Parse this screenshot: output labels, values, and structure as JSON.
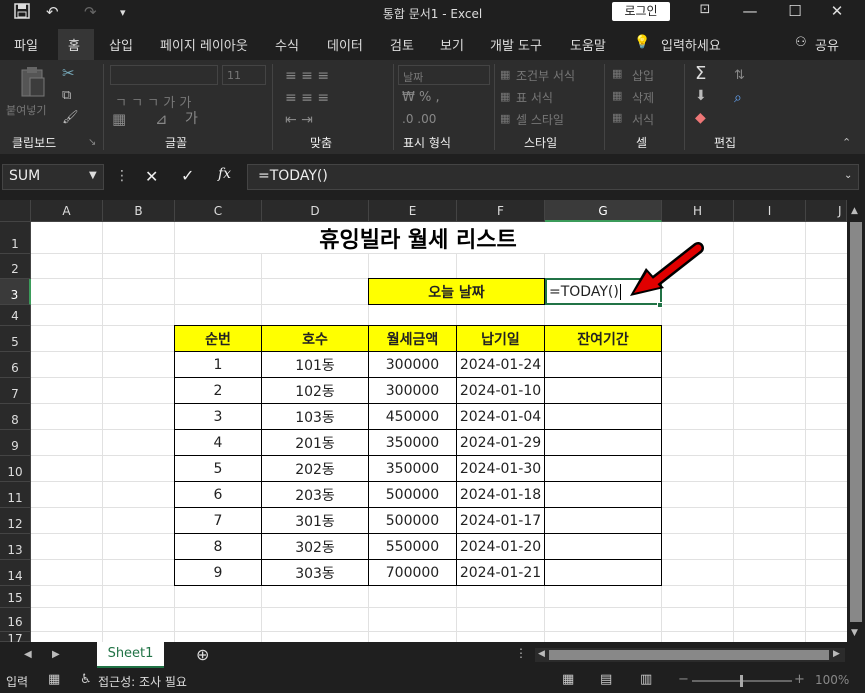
{
  "window": {
    "title": "통합 문서1  -  Excel",
    "login_label": "로그인"
  },
  "menu": {
    "tabs": [
      "파일",
      "홈",
      "삽입",
      "페이지 레이아웃",
      "수식",
      "데이터",
      "검토",
      "보기",
      "개발 도구",
      "도움말"
    ],
    "search_label": "입력하세요",
    "share_label": "공유"
  },
  "ribbon": {
    "groups": [
      "클립보드",
      "글꼴",
      "맞춤",
      "표시 형식",
      "스타일",
      "셀",
      "편집"
    ],
    "paste_label": "붙여넣기",
    "number_format": "날짜",
    "font_size": "11",
    "styles": [
      "조건부 서식",
      "표 서식",
      "셀 스타일"
    ],
    "cells": [
      "삽입",
      "삭제",
      "서식"
    ]
  },
  "formula_bar": {
    "name_box": "SUM",
    "formula": "=TODAY()"
  },
  "columns": [
    "A",
    "B",
    "C",
    "D",
    "E",
    "F",
    "G",
    "H",
    "I",
    "J"
  ],
  "rows": [
    "1",
    "2",
    "3",
    "4",
    "5",
    "6",
    "7",
    "8",
    "9",
    "10",
    "11",
    "12",
    "13",
    "14",
    "15",
    "16",
    "17"
  ],
  "sheet": {
    "title": "휴잉빌라 월세 리스트",
    "today_label": "오늘 날짜",
    "today_value": "=TODAY()",
    "headers": [
      "순번",
      "호수",
      "월세금액",
      "납기일",
      "잔여기간"
    ],
    "records": [
      [
        "1",
        "101동",
        "300000",
        "2024-01-24",
        ""
      ],
      [
        "2",
        "102동",
        "300000",
        "2024-01-10",
        ""
      ],
      [
        "3",
        "103동",
        "450000",
        "2024-01-04",
        ""
      ],
      [
        "4",
        "201동",
        "350000",
        "2024-01-29",
        ""
      ],
      [
        "5",
        "202동",
        "350000",
        "2024-01-30",
        ""
      ],
      [
        "6",
        "203동",
        "500000",
        "2024-01-18",
        ""
      ],
      [
        "7",
        "301동",
        "500000",
        "2024-01-17",
        ""
      ],
      [
        "8",
        "302동",
        "550000",
        "2024-01-20",
        ""
      ],
      [
        "9",
        "303동",
        "700000",
        "2024-01-21",
        ""
      ]
    ]
  },
  "sheet_tabs": [
    "Sheet1"
  ],
  "status": {
    "mode": "입력",
    "accessibility": "접근성: 조사 필요",
    "zoom": "100%"
  },
  "colors": {
    "accent": "#217346",
    "highlight": "#ffff00",
    "arrow": "#e00000"
  }
}
